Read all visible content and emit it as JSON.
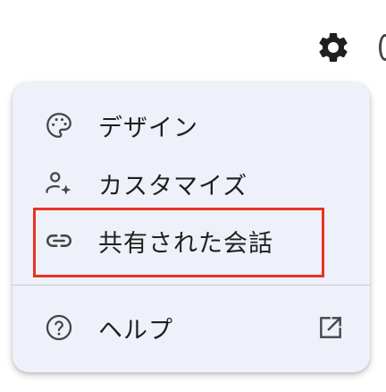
{
  "toolbar": {
    "settings_icon": "gear-icon"
  },
  "menu": {
    "items": [
      {
        "label": "デザイン",
        "icon": "palette-icon"
      },
      {
        "label": "カスタマイズ",
        "icon": "person-sparkle-icon"
      },
      {
        "label": "共有された会話",
        "icon": "link-icon"
      },
      {
        "label": "ヘルプ",
        "icon": "help-circle-icon",
        "trailing_icon": "open-external-icon"
      }
    ]
  },
  "colors": {
    "menu_background": "#eef1f9",
    "text": "#1f1f1f",
    "icon": "#444746",
    "highlight_border": "#ea3323"
  }
}
